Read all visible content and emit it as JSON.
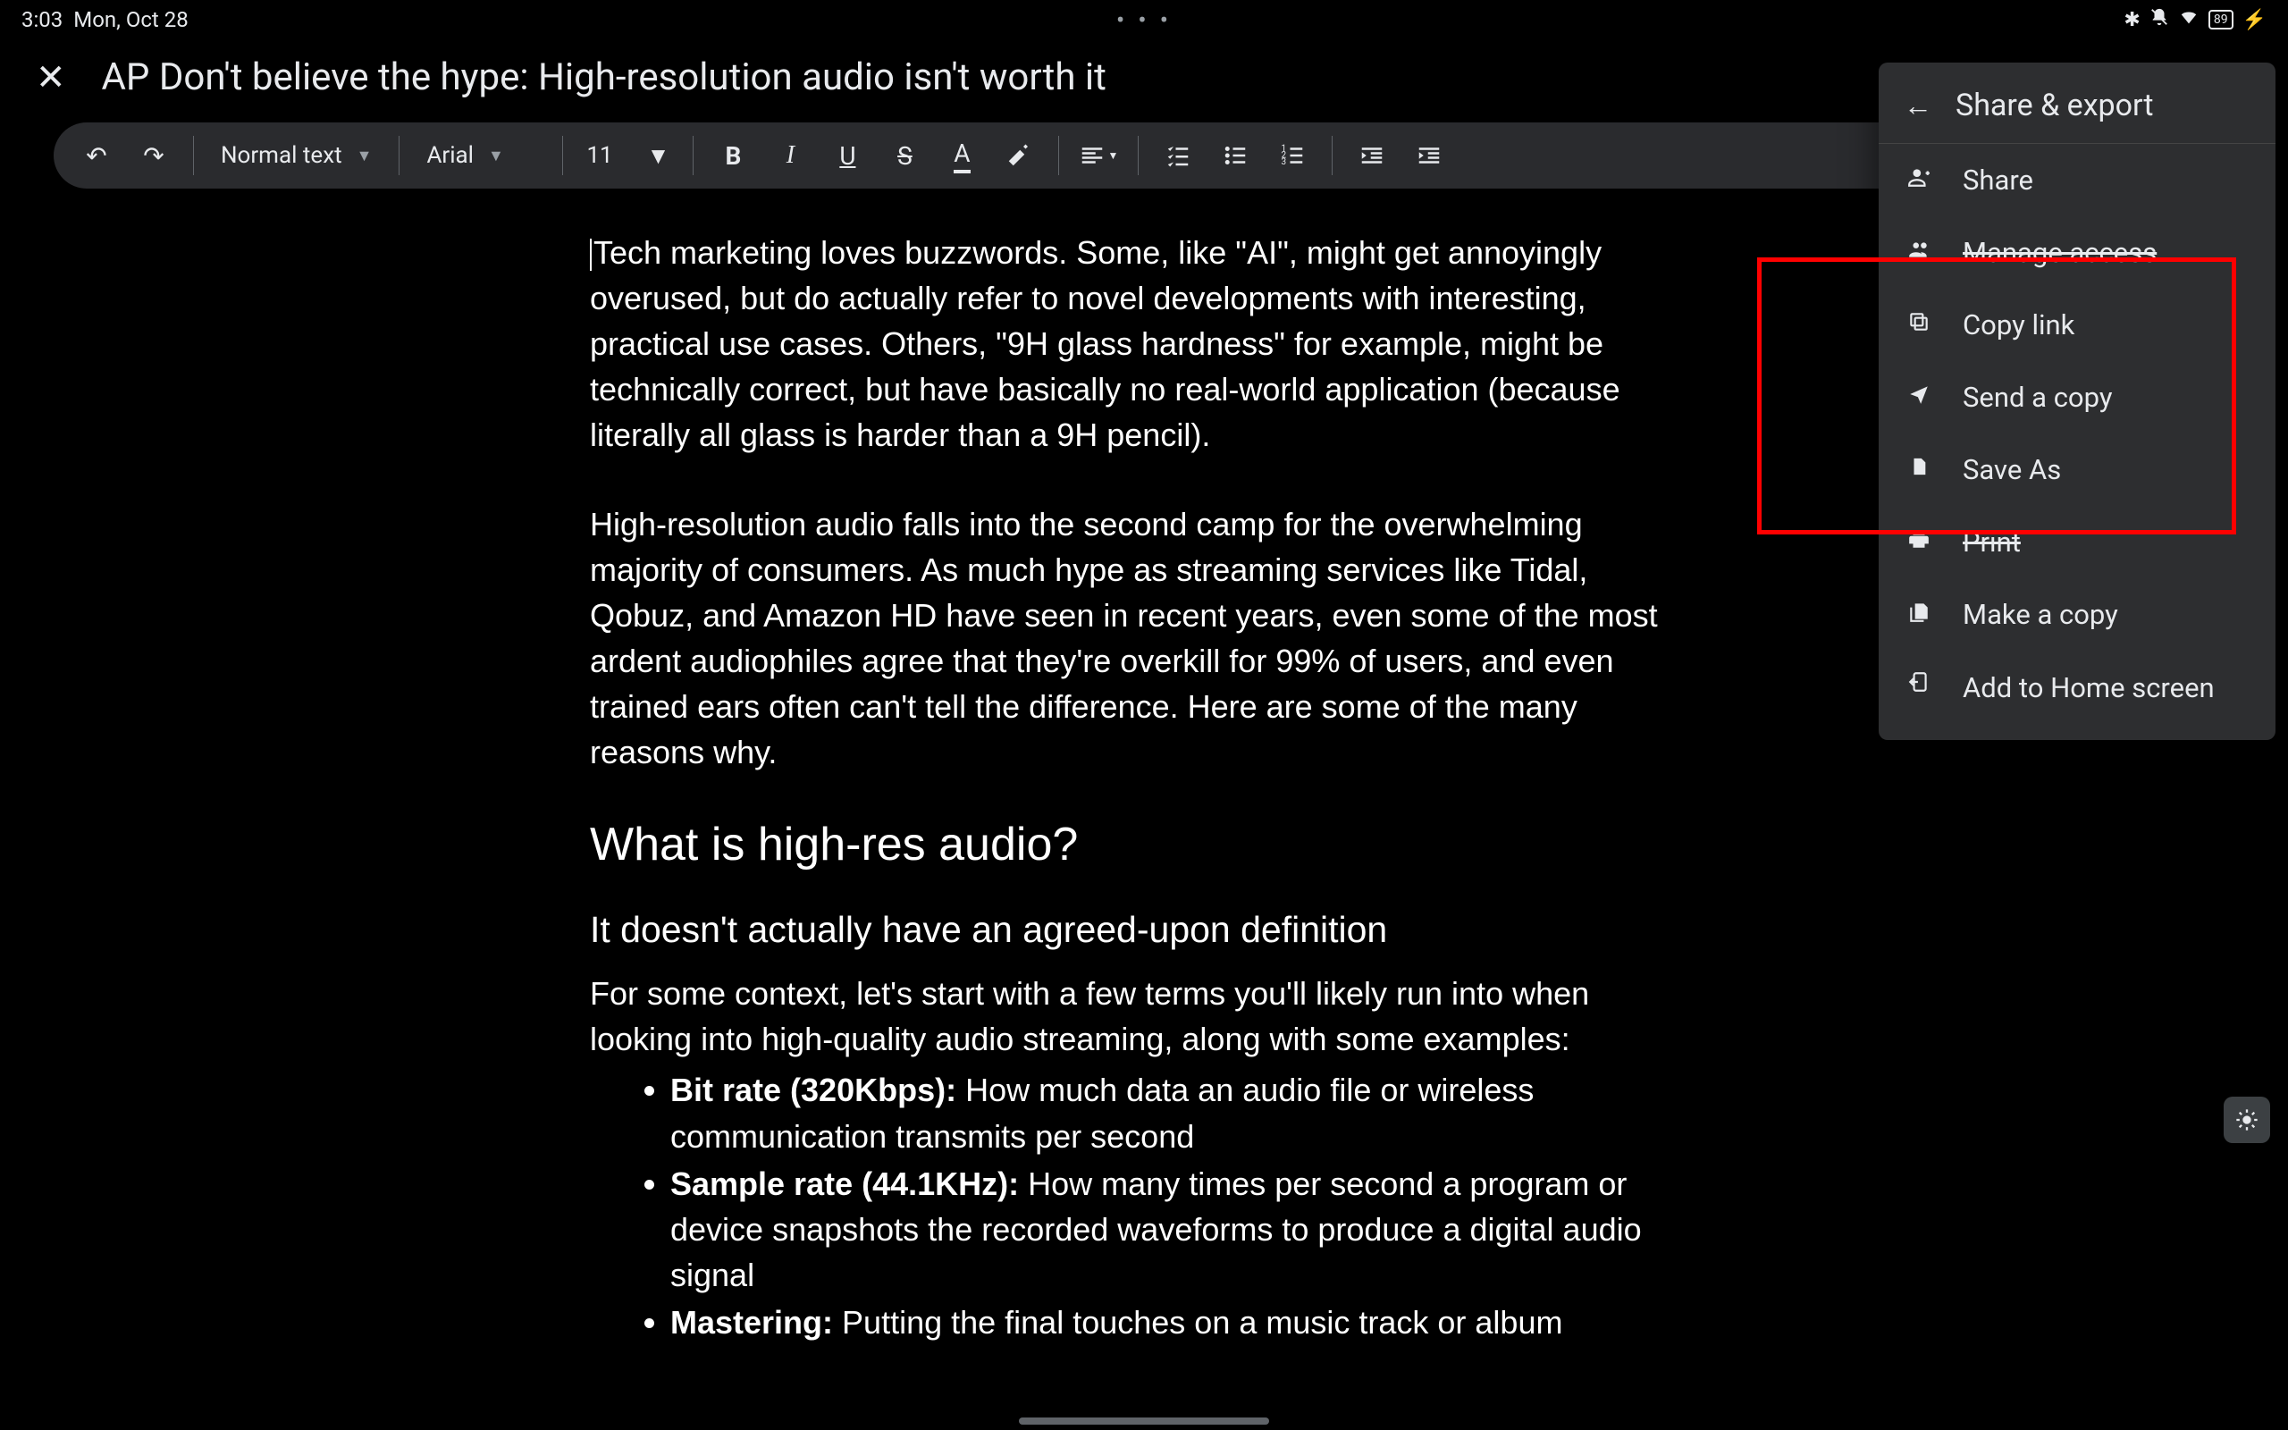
{
  "status": {
    "time": "3:03",
    "date": "Mon, Oct 28",
    "center_dots": "• • •",
    "icons": {
      "bt": "✽",
      "dnd": "🔕",
      "wifi": "📶",
      "batt": "🔋⚡"
    },
    "battery_pct": "89"
  },
  "title": {
    "close": "✕",
    "doc_name": "AP Don't believe the hype: High-resolution audio isn't worth it"
  },
  "toolbar": {
    "undo": "↶",
    "redo": "↷",
    "style_label": "Normal text",
    "font_label": "Arial",
    "font_size": "11",
    "bold": "B",
    "italic": "I",
    "underline": "U",
    "strike": "S",
    "textcolor": "A",
    "highlight": "✎"
  },
  "document": {
    "p1": "Tech marketing loves buzzwords. Some, like \"AI\", might get annoyingly overused, but do actually refer to novel developments with interesting, practical use cases. Others, \"9H glass hardness\" for example, might be technically correct, but have basically no real-world application (because literally all glass is harder than a 9H pencil).",
    "p2": "High-resolution audio falls into the second camp for the overwhelming majority of consumers. As much hype as streaming services like Tidal, Qobuz, and Amazon HD have seen in recent years, even some of the most ardent audiophiles agree that they're overkill for 99% of users, and even trained ears often can't tell the difference. Here are some of the many reasons why.",
    "h2": "What is high-res audio?",
    "h3": "It doesn't actually have an agreed-upon definition",
    "p3": "For some context, let's start with a few terms you'll likely run into when looking into high-quality audio streaming, along with some examples:",
    "li1_bold": "Bit rate (320Kbps):",
    "li1_rest": " How much data an audio file or wireless communication transmits per second",
    "li2_bold": "Sample rate (44.1KHz):",
    "li2_rest": " How many times per second a program or device snapshots the recorded waveforms to produce a digital audio signal",
    "li3_bold": "Mastering:",
    "li3_rest": " Putting the final touches on a music track or album"
  },
  "panel": {
    "title": "Share & export",
    "items": [
      {
        "icon": "⊕",
        "label": "Share"
      },
      {
        "icon": "⚙",
        "label": "Manage access",
        "strike": true
      },
      {
        "icon": "⧉",
        "label": "Copy link"
      },
      {
        "icon": "➤",
        "label": "Send a copy"
      },
      {
        "icon": "📄",
        "label": "Save As"
      },
      {
        "icon": "🖶",
        "label": "Print",
        "strike": true
      },
      {
        "icon": "📑",
        "label": "Make a copy"
      },
      {
        "icon": "⇱",
        "label": "Add to Home screen"
      }
    ]
  }
}
